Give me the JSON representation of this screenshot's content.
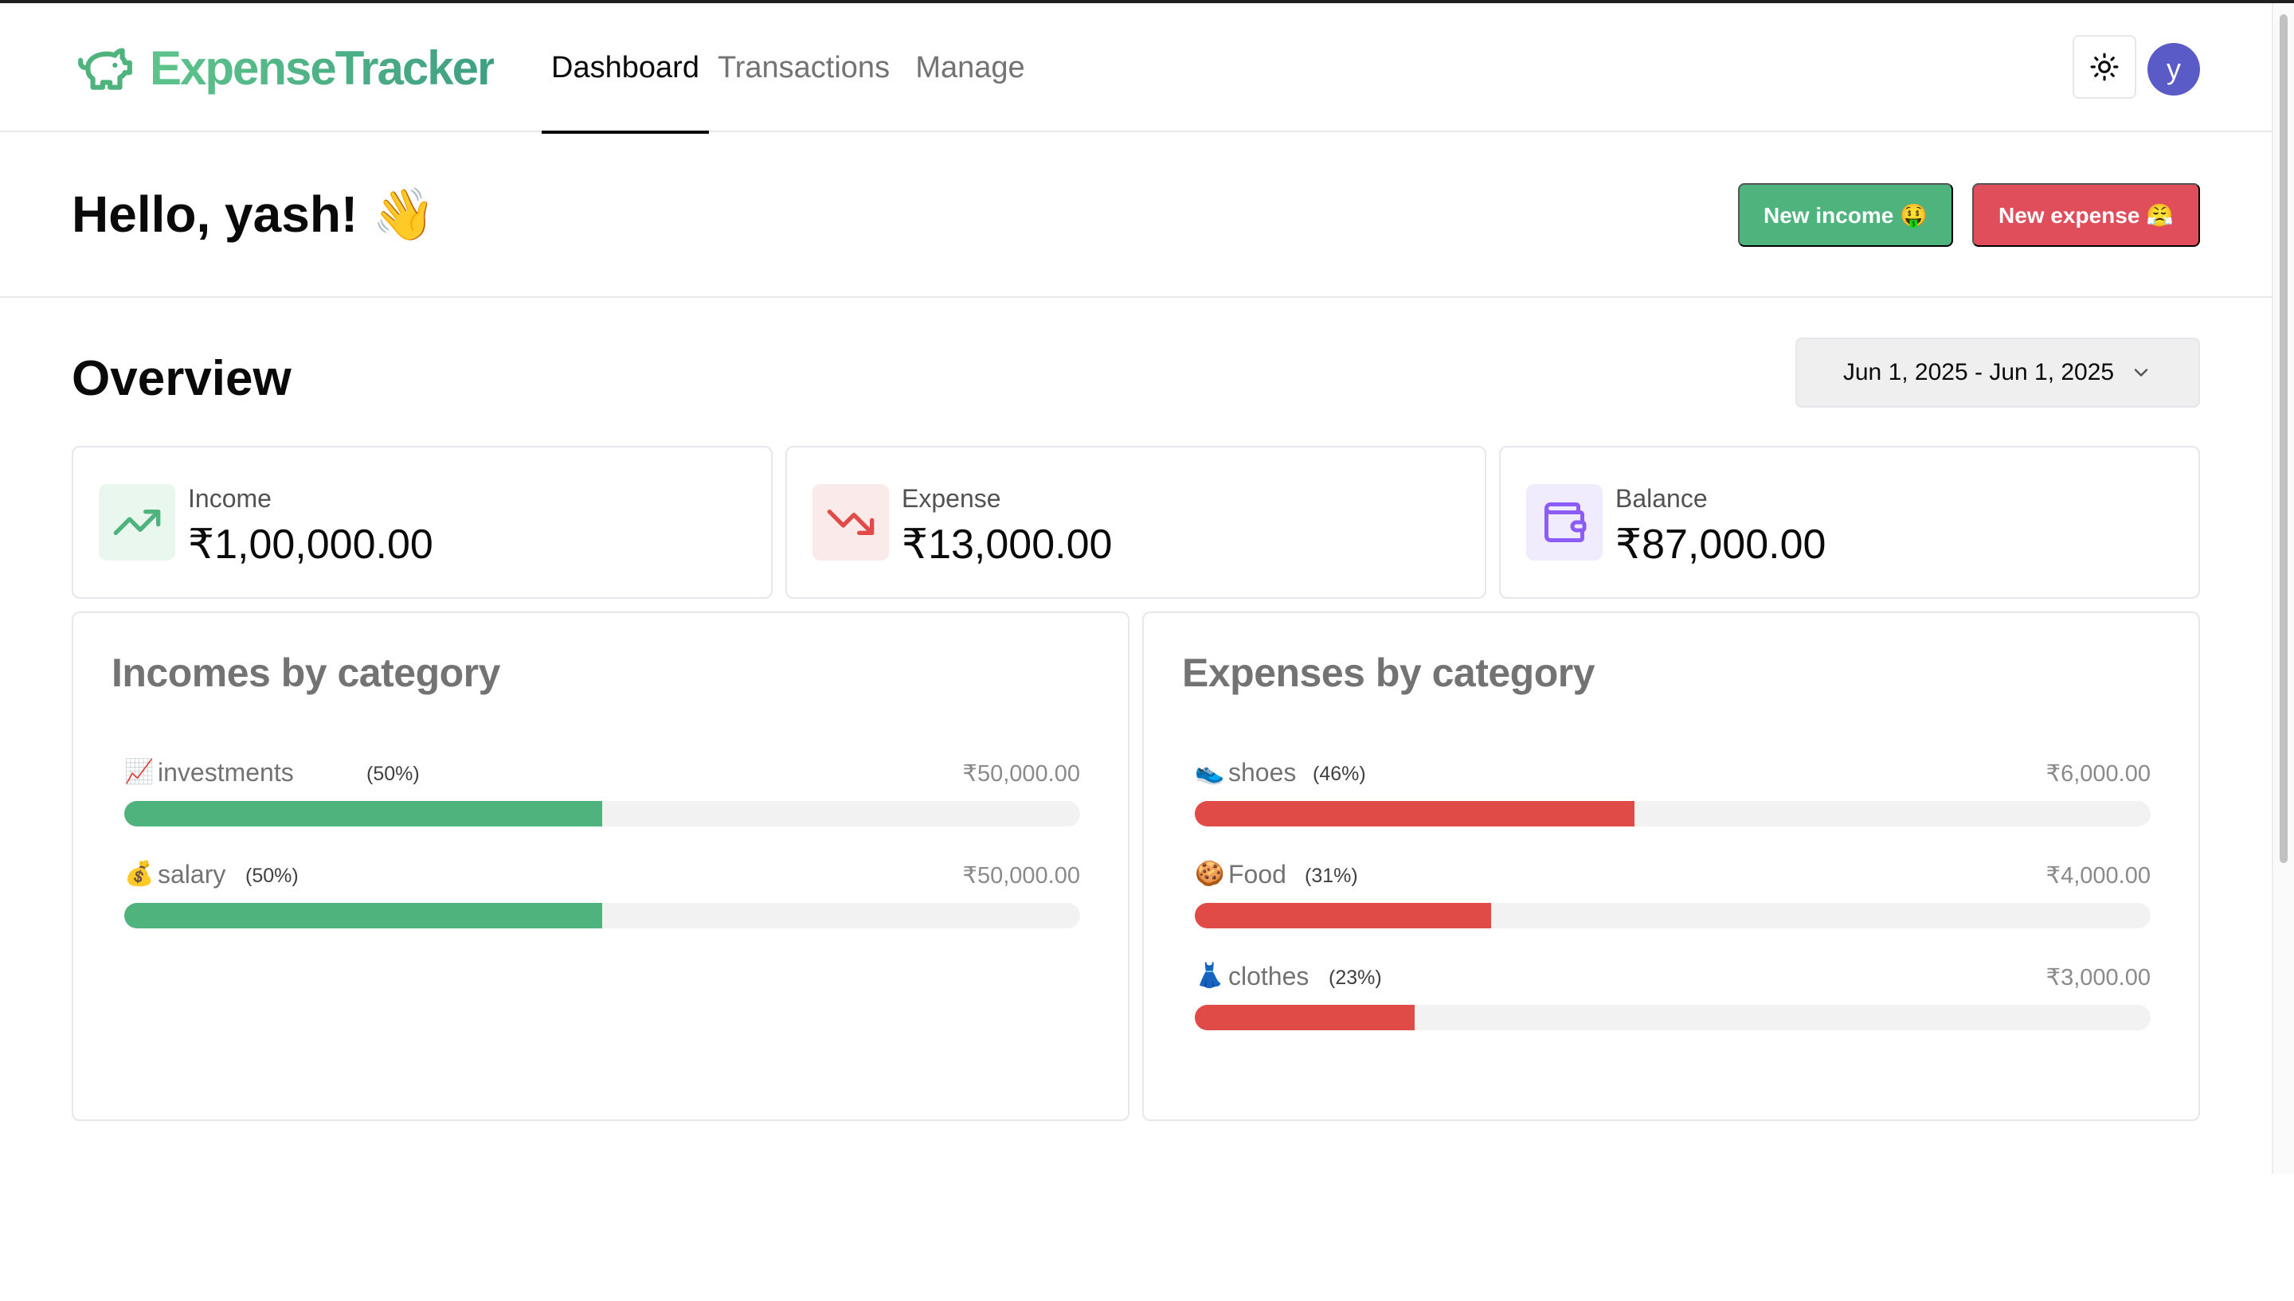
{
  "app": {
    "name": "ExpenseTracker",
    "brand_icon": "piggy-bank-icon"
  },
  "nav": {
    "links": [
      {
        "label": "Dashboard",
        "active": true
      },
      {
        "label": "Transactions",
        "active": false
      },
      {
        "label": "Manage",
        "active": false
      }
    ],
    "theme_toggle_icon": "sun-icon",
    "avatar_initial": "y"
  },
  "greeting": "Hello, yash! 👋",
  "actions": {
    "new_income": "New income 🤑",
    "new_expense": "New expense 😤"
  },
  "overview": {
    "title": "Overview",
    "date_range": "Jun 1, 2025 - Jun 1, 2025",
    "stats": [
      {
        "label": "Income",
        "value": "₹1,00,000.00",
        "icon": "trending-up-icon",
        "color": "#4fb37d"
      },
      {
        "label": "Expense",
        "value": "₹13,000.00",
        "icon": "trending-down-icon",
        "color": "#e04a47"
      },
      {
        "label": "Balance",
        "value": "₹87,000.00",
        "icon": "wallet-icon",
        "color": "#8b5cf6"
      }
    ]
  },
  "incomes": {
    "title": "Incomes by category",
    "items": [
      {
        "emoji": "📈",
        "name": "investments",
        "pct": "(50%)",
        "amount": "₹50,000.00",
        "fraction": 0.5
      },
      {
        "emoji": "💰",
        "name": "salary",
        "pct": "(50%)",
        "amount": "₹50,000.00",
        "fraction": 0.5
      }
    ]
  },
  "expenses": {
    "title": "Expenses by category",
    "items": [
      {
        "emoji": "👟",
        "name": "shoes",
        "pct": "(46%)",
        "amount": "₹6,000.00",
        "fraction": 0.46
      },
      {
        "emoji": "🍪",
        "name": "Food",
        "pct": "(31%)",
        "amount": "₹4,000.00",
        "fraction": 0.31
      },
      {
        "emoji": "👗",
        "name": "clothes",
        "pct": "(23%)",
        "amount": "₹3,000.00",
        "fraction": 0.23
      }
    ]
  },
  "colors": {
    "brand": "#4fb37d",
    "income": "#4fb37d",
    "expense": "#e04a47",
    "avatar": "#5b5bc8"
  }
}
